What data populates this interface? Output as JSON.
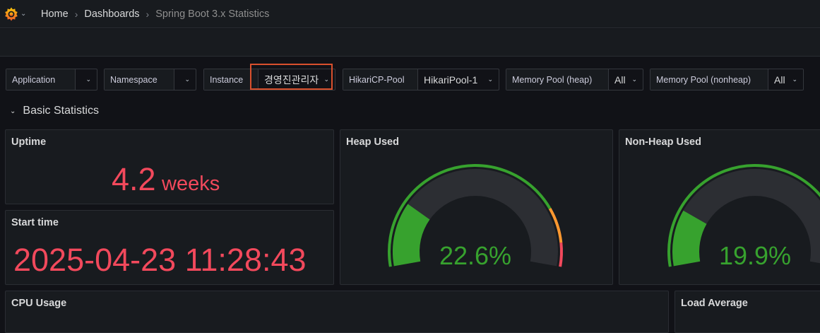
{
  "breadcrumb": {
    "home": "Home",
    "dashboards": "Dashboards",
    "current": "Spring Boot 3.x Statistics"
  },
  "icons": {
    "logo": "grafana-logo-icon",
    "caret": "chevron-down-icon",
    "separator": "chevron-right-icon"
  },
  "variables": [
    {
      "label": "Application",
      "value": ""
    },
    {
      "label": "Namespace",
      "value": ""
    },
    {
      "label": "Instance",
      "value": "경영진관리자"
    },
    {
      "label": "HikariCP-Pool",
      "value": "HikariPool-1"
    },
    {
      "label": "Memory Pool (heap)",
      "value": "All"
    },
    {
      "label": "Memory Pool (nonheap)",
      "value": "All"
    }
  ],
  "row": {
    "title": "Basic Statistics"
  },
  "panels": {
    "uptime": {
      "title": "Uptime",
      "value": "4.2",
      "unit": "weeks"
    },
    "start_time": {
      "title": "Start time",
      "value": "2025-04-23 11:28:43"
    },
    "heap_used": {
      "title": "Heap Used",
      "value": "22.6%",
      "fraction": 0.226
    },
    "non_heap_used": {
      "title": "Non-Heap Used",
      "value": "19.9%",
      "fraction": 0.199
    },
    "cpu_usage": {
      "title": "CPU Usage"
    },
    "load_average": {
      "title": "Load Average"
    }
  },
  "colors": {
    "stat_red": "#f2495c",
    "gauge_green": "#37a22e",
    "gauge_orange": "#ff9830",
    "gauge_red": "#f2495c",
    "highlight": "#d9502d"
  }
}
